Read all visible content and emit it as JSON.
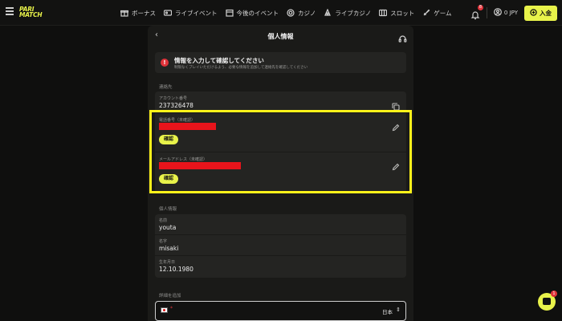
{
  "brand": {
    "line1": "PARI",
    "line2": "MATCH",
    "accent": "#e8f24a"
  },
  "nav": [
    {
      "label": "ボーナス",
      "icon": "gift-icon"
    },
    {
      "label": "ライブイベント",
      "icon": "live-event-icon"
    },
    {
      "label": "今後のイベント",
      "icon": "calendar-icon"
    },
    {
      "label": "カジノ",
      "icon": "casino-chip-icon"
    },
    {
      "label": "ライブカジノ",
      "icon": "live-casino-icon"
    },
    {
      "label": "スロット",
      "icon": "slot-icon"
    },
    {
      "label": "ゲーム",
      "icon": "rocket-icon"
    }
  ],
  "topbar": {
    "notif_count": "8",
    "balance": "0 JPY",
    "deposit_label": "入金"
  },
  "panel": {
    "title": "個人情報"
  },
  "alert": {
    "title": "情報を入力して確認してください",
    "subtitle": "制限なくプレイいただけるよう、必要な情報を追加して連絡先を確認してください"
  },
  "contact": {
    "section_label": "連絡先",
    "account_label": "アカウント番号",
    "account_value": "237326478",
    "phone_label": "電話番号（未確認）",
    "email_label": "メールアドレス（未確認）",
    "confirm_label": "確認"
  },
  "personal": {
    "section_label": "個人情報",
    "first_name_label": "名前",
    "first_name_value": "youta",
    "last_name_label": "名字",
    "last_name_value": "misaki",
    "dob_label": "生年月日",
    "dob_value": "12.10.1980"
  },
  "details": {
    "section_label": "詳細を追加",
    "country_value": "日本"
  },
  "chat": {
    "badge": "1"
  },
  "colors": {
    "highlight": "#fff31a",
    "redaction": "#e8141b",
    "error": "#e0333a"
  }
}
